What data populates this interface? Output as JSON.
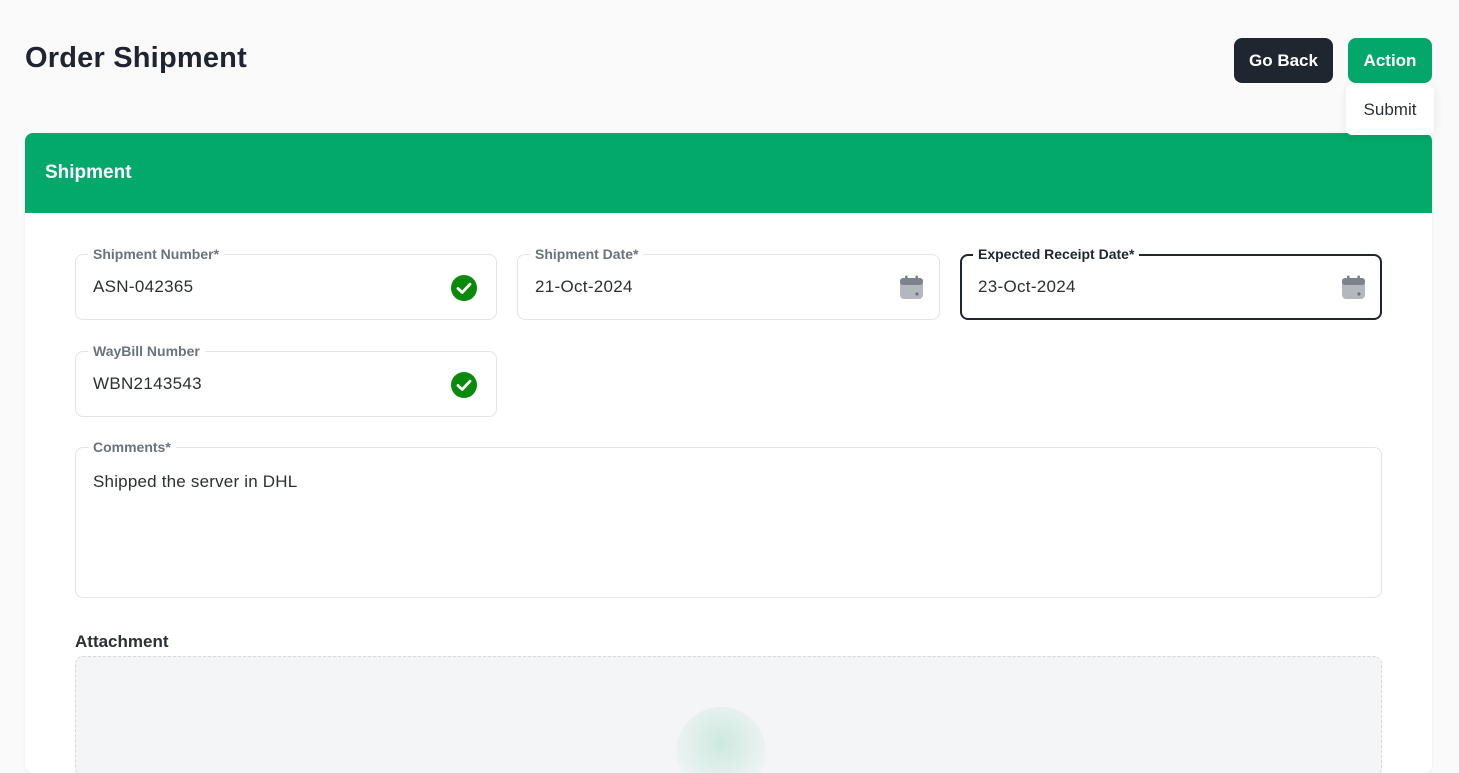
{
  "page": {
    "title": "Order Shipment"
  },
  "header_actions": {
    "go_back_label": "Go Back",
    "action_label": "Action",
    "action_menu": [
      "Submit"
    ]
  },
  "card": {
    "title": "Shipment"
  },
  "fields": {
    "shipment_number": {
      "label": "Shipment Number*",
      "value": "ASN-042365",
      "status_icon": "check-circle-icon"
    },
    "shipment_date": {
      "label": "Shipment Date*",
      "value": "21-Oct-2024",
      "icon": "calendar-icon"
    },
    "expected_receipt_date": {
      "label": "Expected Receipt Date*",
      "value": "23-Oct-2024",
      "icon": "calendar-icon",
      "focused": true
    },
    "waybill_number": {
      "label": "WayBill Number",
      "value": "WBN2143543",
      "status_icon": "check-circle-icon"
    },
    "comments": {
      "label": "Comments*",
      "value": "Shipped the server in DHL"
    }
  },
  "attachment": {
    "label": "Attachment"
  },
  "colors": {
    "brand_green": "#03a86b",
    "dark_button": "#1f2630",
    "check_green": "#0a8a0a"
  }
}
